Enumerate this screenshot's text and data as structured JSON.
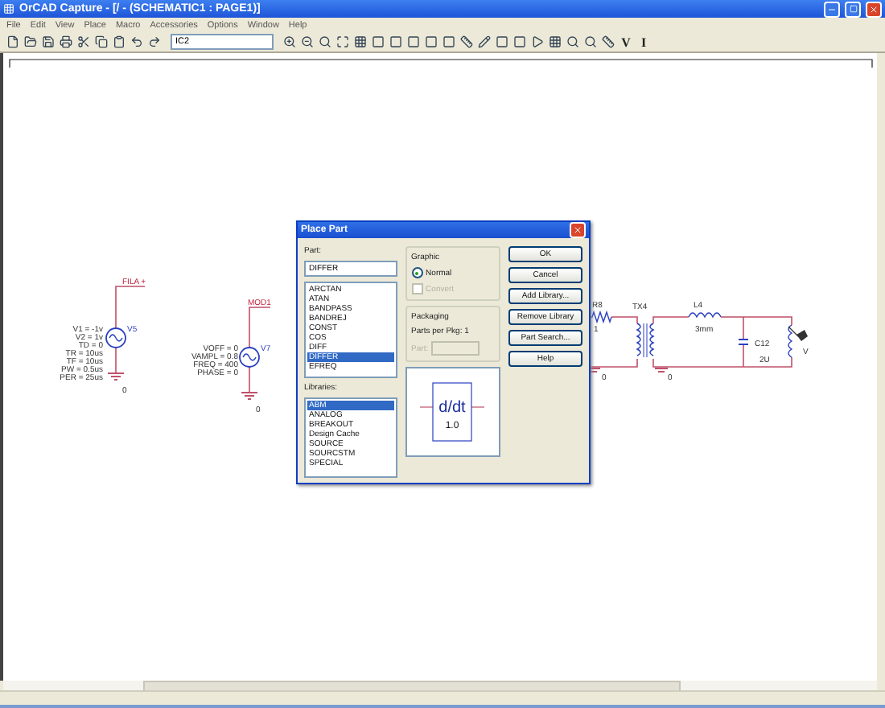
{
  "window": {
    "title": "OrCAD Capture - [/ - (SCHEMATIC1 : PAGE1)]"
  },
  "menu": [
    "File",
    "Edit",
    "View",
    "Place",
    "Macro",
    "Accessories",
    "Options",
    "Window",
    "Help"
  ],
  "toolbar": {
    "part_combo": "IC2",
    "text_tools": [
      "V",
      "I"
    ]
  },
  "schematic": {
    "sources": [
      {
        "name": "V5",
        "net": "FILA +",
        "ground": "0",
        "params": [
          "V1 = -1v",
          "V2 = 1v",
          "TD = 0",
          "TR = 10us",
          "TF = 10us",
          "PW = 0.5us",
          "PER = 25us"
        ]
      },
      {
        "name": "V7",
        "net": "MOD1",
        "ground": "0",
        "params": [
          "VOFF = 0",
          "VAMPL = 0.8",
          "FREQ = 400",
          "PHASE = 0"
        ]
      }
    ],
    "circuit": {
      "resistor": {
        "name": "R8",
        "value": "1"
      },
      "transformer": "TX4",
      "inductor": {
        "name": "L4",
        "value": "3mm"
      },
      "capacitor": {
        "name": "C12",
        "value": "2U"
      },
      "grounds": [
        "0",
        "0"
      ],
      "probe": "V"
    }
  },
  "dialog": {
    "title": "Place Part",
    "part_label": "Part:",
    "part_value": "DIFFER",
    "parts": [
      {
        "label": "ARCTAN",
        "selected": false
      },
      {
        "label": "ATAN",
        "selected": false
      },
      {
        "label": "BANDPASS",
        "selected": false
      },
      {
        "label": "BANDREJ",
        "selected": false
      },
      {
        "label": "CONST",
        "selected": false
      },
      {
        "label": "COS",
        "selected": false
      },
      {
        "label": "DIFF",
        "selected": false
      },
      {
        "label": "DIFFER",
        "selected": true
      },
      {
        "label": "EFREQ",
        "selected": false
      }
    ],
    "libraries_label": "Libraries:",
    "libraries": [
      {
        "label": "ABM",
        "selected": true
      },
      {
        "label": "ANALOG",
        "selected": false
      },
      {
        "label": "BREAKOUT",
        "selected": false
      },
      {
        "label": "Design Cache",
        "selected": false
      },
      {
        "label": "SOURCE",
        "selected": false
      },
      {
        "label": "SOURCSTM",
        "selected": false
      },
      {
        "label": "SPECIAL",
        "selected": false
      }
    ],
    "graphic": {
      "label": "Graphic",
      "normal": {
        "label": "Normal",
        "selected": true
      },
      "convert": {
        "label": "Convert",
        "checked": false,
        "disabled": true
      }
    },
    "packaging": {
      "label": "Packaging",
      "parts_per_pkg": "Parts per Pkg:  1",
      "part_label": "Part:",
      "part_disabled": true
    },
    "buttons": [
      "OK",
      "Cancel",
      "Add Library...",
      "Remove Library",
      "Part Search...",
      "Help"
    ],
    "preview": {
      "symbol": "d/dt",
      "value": "1.0"
    }
  }
}
